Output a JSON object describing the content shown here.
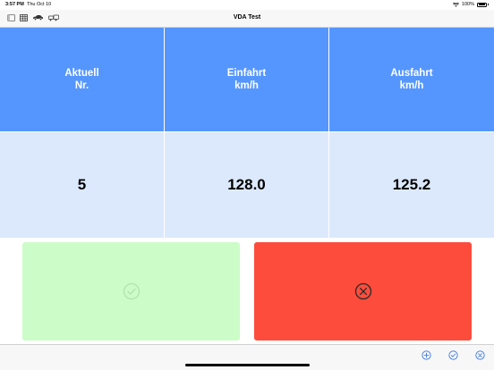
{
  "status_bar": {
    "time": "3:57 PM",
    "date": "Thu Oct 10",
    "battery": "100%",
    "icons": [
      "wifi-icon",
      "battery-icon"
    ]
  },
  "nav": {
    "title": "VDA Test",
    "icons": [
      "sidebar-icon",
      "table-icon",
      "car-icon",
      "vehicle-group-icon"
    ]
  },
  "table": {
    "headers": [
      {
        "line1": "Aktuell",
        "line2": "Nr."
      },
      {
        "line1": "Einfahrt",
        "line2": "km/h"
      },
      {
        "line1": "Ausfahrt",
        "line2": "km/h"
      }
    ],
    "values": [
      "5",
      "128.0",
      "125.2"
    ]
  },
  "buttons": {
    "confirm": {
      "icon": "checkmark-circle-icon",
      "color": "#ccfdc8"
    },
    "cancel": {
      "icon": "x-circle-icon",
      "color": "#fe4c3c"
    }
  },
  "toolbar": {
    "icons": [
      "plus-circle-icon",
      "checkmark-circle-icon",
      "x-circle-icon"
    ],
    "accent": "#2f6fe0"
  },
  "colors": {
    "header_bg": "#5596fe",
    "value_bg": "#dce9fc"
  }
}
